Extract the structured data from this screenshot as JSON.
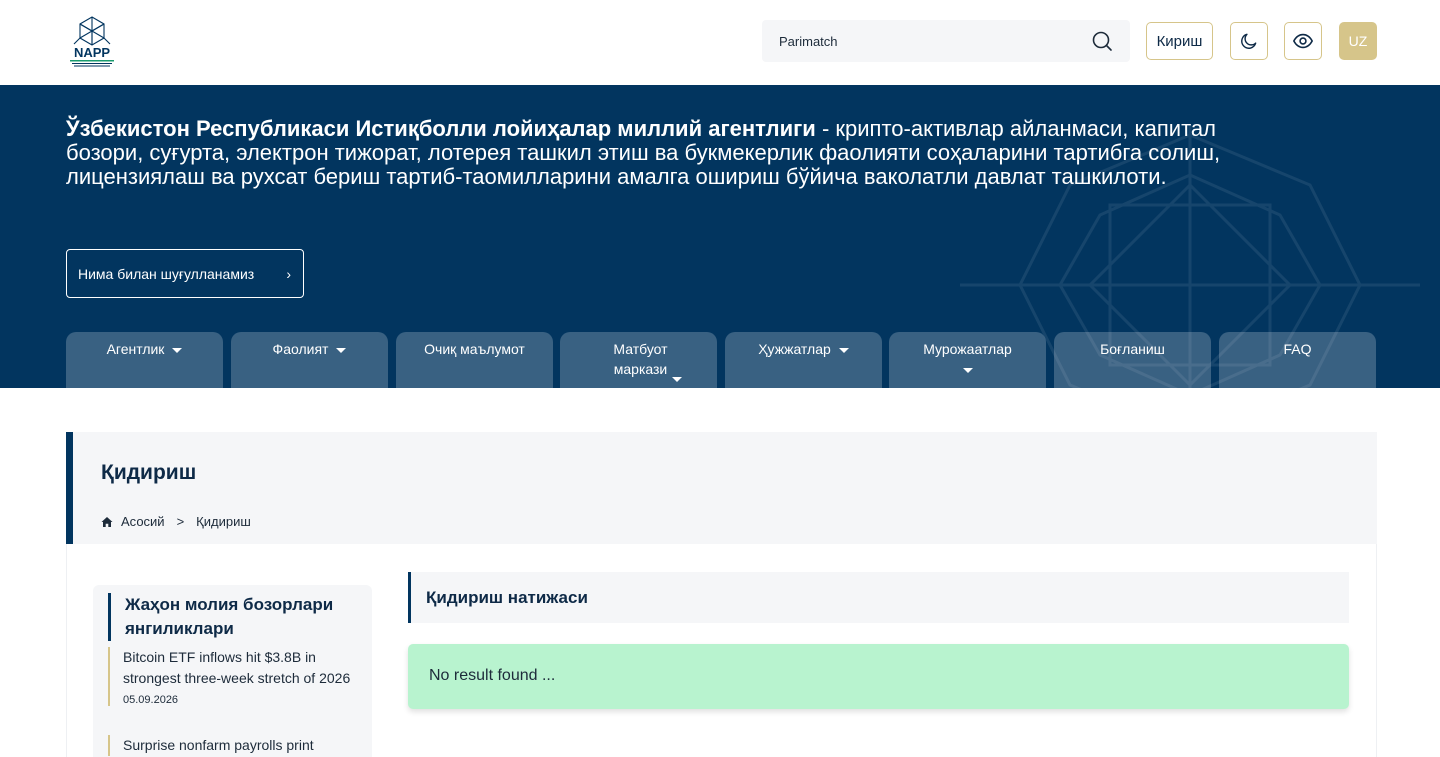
{
  "header": {
    "logo_text": "NAPP",
    "search": {
      "value": "Parimatch",
      "placeholder": ""
    },
    "login_label": "Кириш",
    "lang_label": "UZ",
    "colors": {
      "gold": "#d6c58a",
      "navy": "#02355f"
    }
  },
  "hero": {
    "title_bold": "Ўзбекистон Республикаси Истиқболли лойиҳалар миллий агентлиги",
    "title_rest": " - крипто-активлар айланмаси, капитал бозори, суғурта, электрон тижорат, лотерея ташкил этиш ва букмекерлик фаолияти соҳаларини тартибга солиш, лицензиялаш ва рухсат бериш тартиб-таомилларини амалга ошириш бўйича ваколатли давлат ташкилоти.",
    "cta_label": "Нима билан шуғулланамиз",
    "cta_icon": "chevron-right-icon"
  },
  "nav": {
    "tabs": [
      {
        "label": "Агентлик",
        "dropdown": true
      },
      {
        "label": "Фаолият",
        "dropdown": true
      },
      {
        "label": "Очиқ маълумот",
        "dropdown": false
      },
      {
        "label": "Матбуот маркази",
        "dropdown": true
      },
      {
        "label": "Ҳужжатлар",
        "dropdown": true
      },
      {
        "label": "Мурожаатлар",
        "dropdown": true
      },
      {
        "label": "Боғланиш",
        "dropdown": false
      },
      {
        "label": "FAQ",
        "dropdown": false
      }
    ]
  },
  "page": {
    "title": "Қидириш",
    "breadcrumb": {
      "home": "Асосий",
      "separator": ">",
      "current": "Қидириш"
    }
  },
  "news": {
    "title": "Жаҳон молия бозорлари янгиликлари",
    "items": [
      {
        "title": "Bitcoin ETF inflows hit $3.8B in strongest three-week stretch of 2026",
        "date": "05.09.2026"
      },
      {
        "title": "Surprise nonfarm payrolls print",
        "date": ""
      }
    ]
  },
  "results": {
    "title": "Қидириш натижаси",
    "empty_message": "No result found ..."
  }
}
